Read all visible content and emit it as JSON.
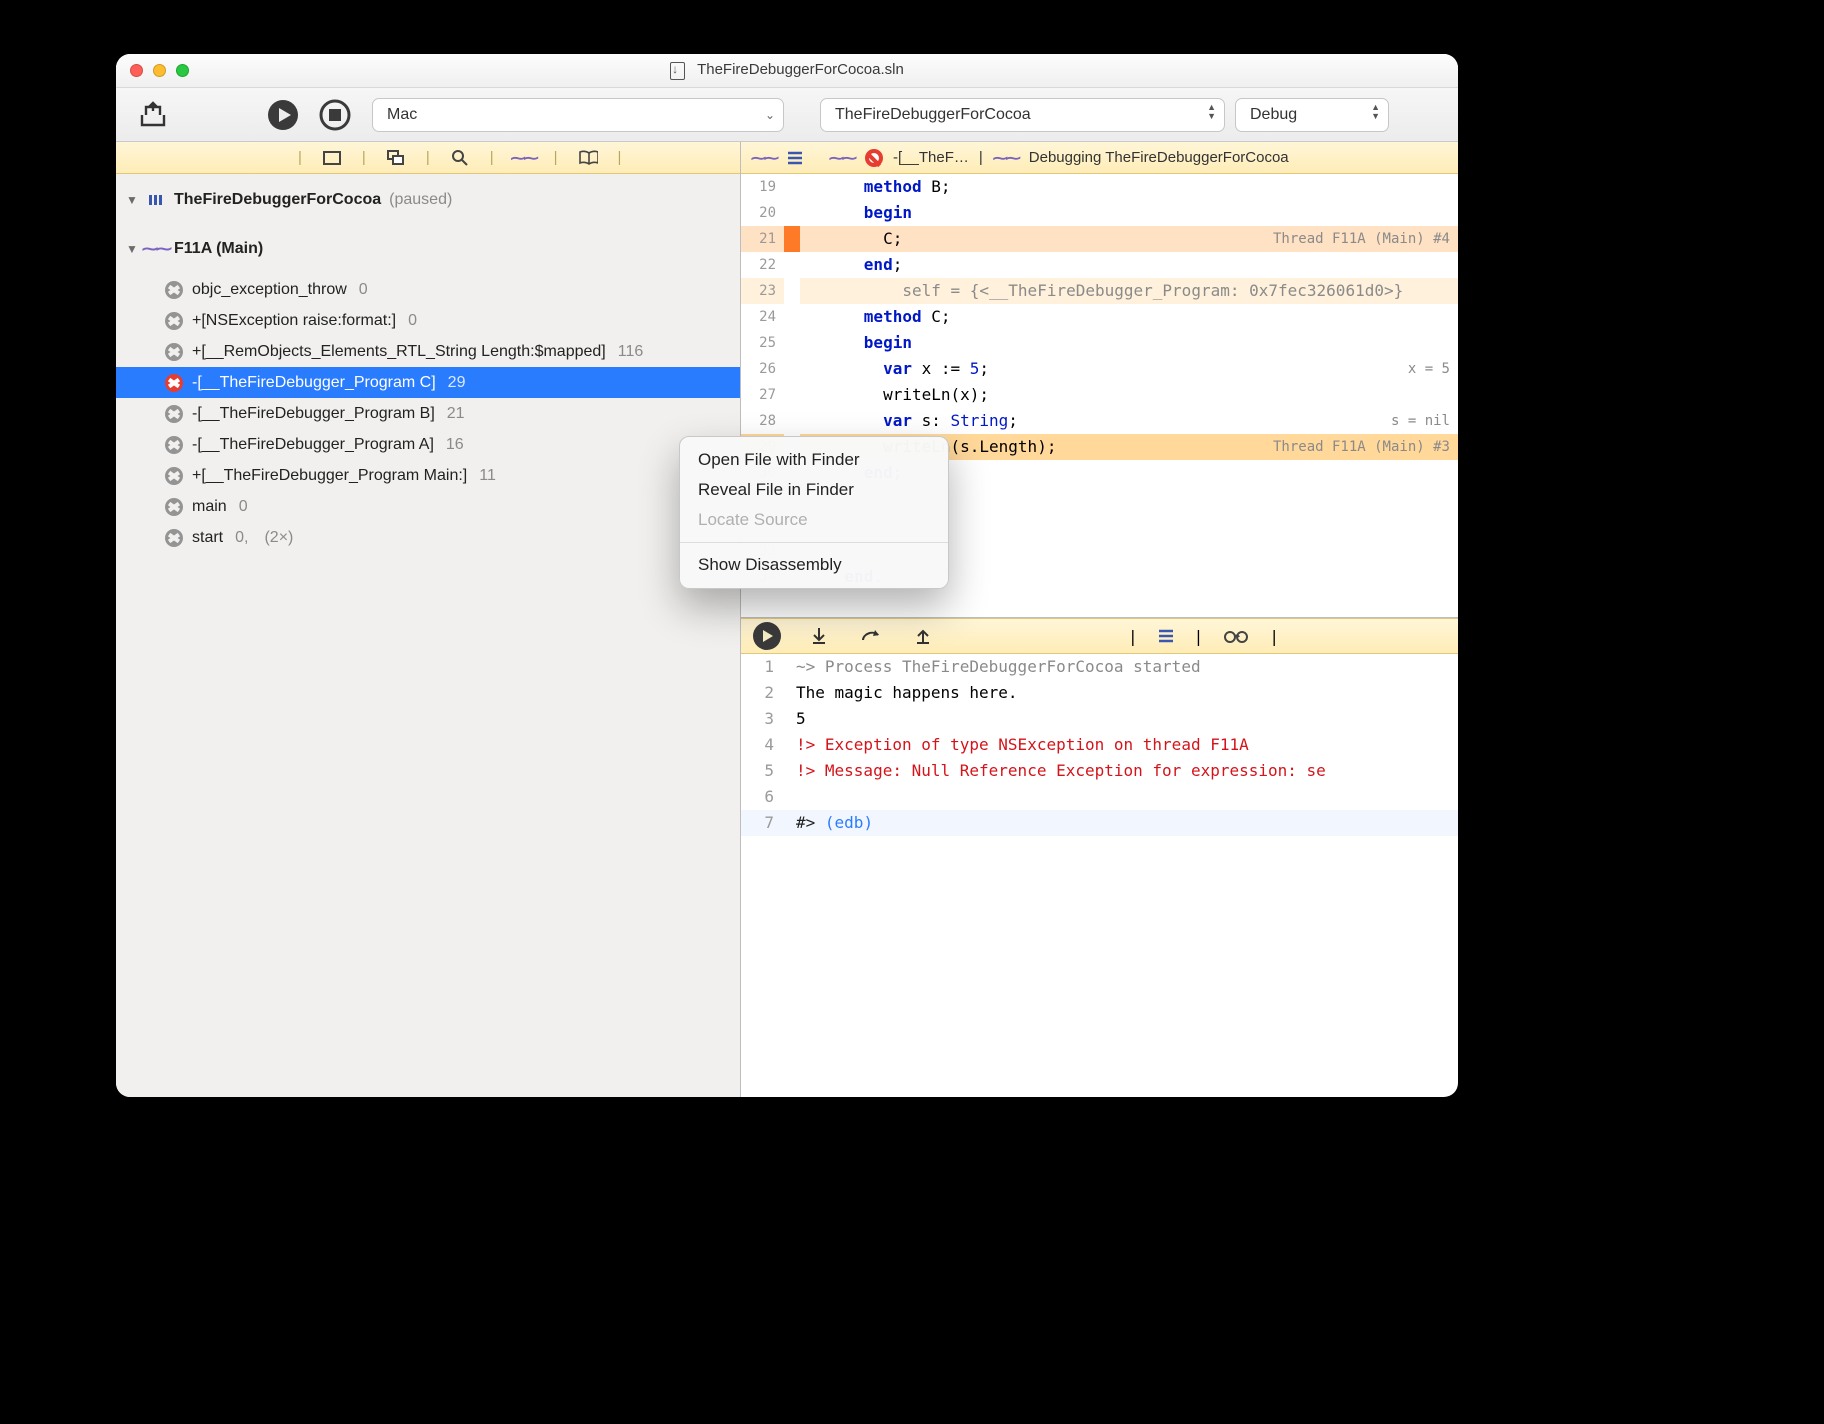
{
  "title": "TheFireDebuggerForCocoa.sln",
  "toolbar": {
    "target": "Mac",
    "project": "TheFireDebuggerForCocoa",
    "config": "Debug"
  },
  "sidebar": {
    "process": {
      "name": "TheFireDebuggerForCocoa",
      "state": "(paused)"
    },
    "thread": {
      "name": "F11A (Main)"
    },
    "frames": [
      {
        "label": "objc_exception_throw",
        "num": "0",
        "glyph": "gray"
      },
      {
        "label": "+[NSException raise:format:]",
        "num": "0",
        "glyph": "gray"
      },
      {
        "label": "+[__RemObjects_Elements_RTL_String Length:$mapped]",
        "num": "116",
        "glyph": "gray"
      },
      {
        "label": "-[__TheFireDebugger_Program C]",
        "num": "29",
        "glyph": "red",
        "selected": true
      },
      {
        "label": "-[__TheFireDebugger_Program B]",
        "num": "21",
        "glyph": "gray"
      },
      {
        "label": "-[__TheFireDebugger_Program A]",
        "num": "16",
        "glyph": "gray"
      },
      {
        "label": "+[__TheFireDebugger_Program Main:]",
        "num": "11",
        "glyph": "gray"
      },
      {
        "label": "main",
        "num": "0",
        "glyph": "gray"
      },
      {
        "label": "start",
        "num": "0,",
        "mult": "(2×)",
        "glyph": "gray"
      }
    ]
  },
  "context_menu": [
    "Open File with Finder",
    "Reveal File in Finder",
    "Locate Source",
    "Show Disassembly"
  ],
  "editor": {
    "crumb_frame": "-[__TheF…",
    "crumb_status": "Debugging TheFireDebuggerForCocoa",
    "lines": [
      {
        "n": 19,
        "indent": 3,
        "tokens": [
          [
            "kw",
            "method"
          ],
          [
            "",
            " B;"
          ]
        ]
      },
      {
        "n": 20,
        "indent": 3,
        "tokens": [
          [
            "kw",
            "begin"
          ]
        ]
      },
      {
        "n": 21,
        "indent": 4,
        "tokens": [
          [
            "",
            "C;"
          ]
        ],
        "hl": "step",
        "ann": "Thread F11A (Main) #4"
      },
      {
        "n": 22,
        "indent": 3,
        "tokens": [
          [
            "kw",
            "end"
          ],
          [
            "",
            ";"
          ]
        ]
      },
      {
        "n": 23,
        "indent": 5,
        "tokens": [
          [
            "cmt",
            "self = {<__TheFireDebugger_Program: 0x7fec326061d0>}"
          ]
        ],
        "hl": "inline"
      },
      {
        "n": 24,
        "indent": 3,
        "tokens": [
          [
            "kw",
            "method"
          ],
          [
            "",
            " C;"
          ]
        ]
      },
      {
        "n": 25,
        "indent": 3,
        "tokens": [
          [
            "kw",
            "begin"
          ]
        ]
      },
      {
        "n": 26,
        "indent": 4,
        "tokens": [
          [
            "kw",
            "var"
          ],
          [
            "",
            " x := "
          ],
          [
            "num",
            "5"
          ],
          [
            "",
            ";"
          ]
        ],
        "ann": "x = 5"
      },
      {
        "n": 27,
        "indent": 4,
        "tokens": [
          [
            "",
            "writeLn(x);"
          ]
        ]
      },
      {
        "n": 28,
        "indent": 4,
        "tokens": [
          [
            "kw",
            "var"
          ],
          [
            "",
            " s: "
          ],
          [
            "kwn",
            "String"
          ],
          [
            "",
            ";"
          ]
        ],
        "ann": "s = nil"
      },
      {
        "n": 29,
        "indent": 4,
        "tokens": [
          [
            "",
            "writeLn(s.Length);"
          ]
        ],
        "hl": "frame",
        "ann": "Thread F11A (Main) #3"
      },
      {
        "n": 30,
        "indent": 3,
        "tokens": [
          [
            "kw",
            "end"
          ],
          [
            "",
            ";"
          ]
        ]
      },
      {
        "n": "",
        "indent": 0,
        "tokens": [
          [
            "",
            ""
          ]
        ]
      },
      {
        "n": "",
        "indent": 0,
        "tokens": [
          [
            "",
            ""
          ]
        ]
      },
      {
        "n": 33,
        "indent": 0,
        "tokens": [
          [
            "",
            ""
          ]
        ]
      },
      {
        "n": 34,
        "indent": 2,
        "tokens": [
          [
            "kw",
            "end"
          ],
          [
            "",
            "."
          ]
        ]
      }
    ]
  },
  "console": {
    "lines": [
      {
        "n": 1,
        "cls": "cinfo",
        "text": "~> Process TheFireDebuggerForCocoa started"
      },
      {
        "n": 2,
        "cls": "",
        "text": "The magic happens here."
      },
      {
        "n": 3,
        "cls": "",
        "text": "5"
      },
      {
        "n": 4,
        "cls": "cerr",
        "text": "!> Exception of type NSException on thread F11A"
      },
      {
        "n": 5,
        "cls": "cerr",
        "text": "!> Message: Null Reference Exception for expression: se"
      },
      {
        "n": 6,
        "cls": "",
        "text": ""
      },
      {
        "n": 7,
        "cls": "cprompt",
        "text": "#> ",
        "suffix": "(edb)",
        "cursor": true
      }
    ]
  }
}
